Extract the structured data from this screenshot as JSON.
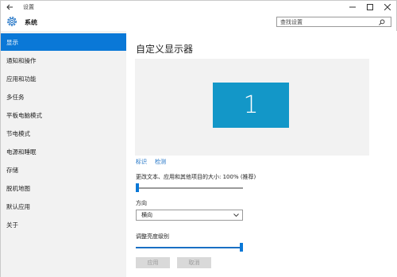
{
  "window": {
    "title": "设置",
    "back_icon": "arrow-left-icon",
    "minimize_icon": "minimize-icon",
    "maximize_icon": "maximize-icon",
    "close_icon": "close-icon"
  },
  "header": {
    "icon": "gear-icon",
    "title": "系统",
    "search_placeholder": "查找设置",
    "search_icon": "search-icon"
  },
  "sidebar": {
    "items": [
      {
        "label": "显示",
        "active": true
      },
      {
        "label": "通知和操作",
        "active": false
      },
      {
        "label": "应用和功能",
        "active": false
      },
      {
        "label": "多任务",
        "active": false
      },
      {
        "label": "平板电脑模式",
        "active": false
      },
      {
        "label": "节电模式",
        "active": false
      },
      {
        "label": "电源和睡眠",
        "active": false
      },
      {
        "label": "存储",
        "active": false
      },
      {
        "label": "脱机地图",
        "active": false
      },
      {
        "label": "默认应用",
        "active": false
      },
      {
        "label": "关于",
        "active": false
      }
    ]
  },
  "main": {
    "title": "自定义显示器",
    "monitor_number": "1",
    "identify_link": "标识",
    "detect_link": "检测",
    "scale_label": "更改文本、应用和其他项目的大小: 100% (推荐)",
    "scale_level": 0.0,
    "orientation_label": "方向",
    "orientation_value": "横向",
    "brightness_label": "调整亮度级别",
    "brightness_level": 1.0,
    "apply_button": "应用",
    "cancel_button": "取消"
  },
  "colors": {
    "accent": "#0a78d7",
    "monitor_tile": "#1397c8",
    "sidebar_bg": "#f2f2f2",
    "link": "#1a6fc4",
    "disabled_button_bg": "#d9d9d9"
  }
}
